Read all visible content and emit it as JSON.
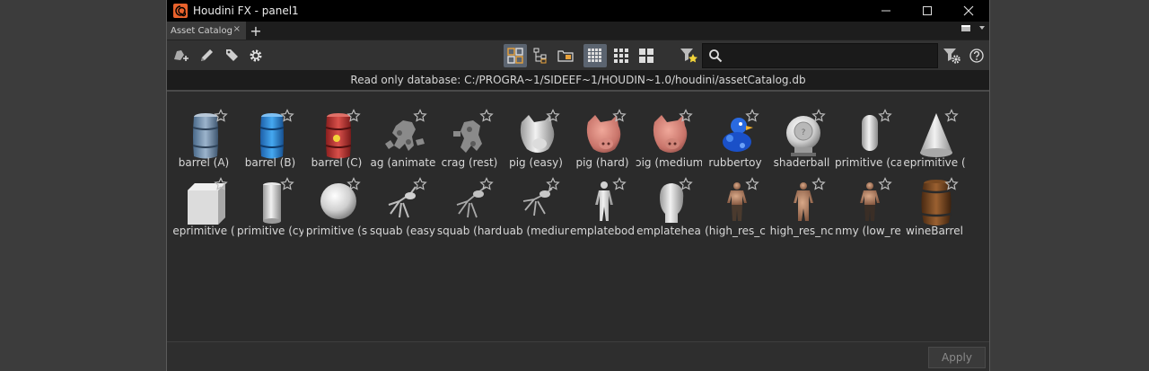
{
  "window": {
    "title": "Houdini FX - panel1"
  },
  "tabs": [
    {
      "label": "Asset Catalog",
      "close": "×"
    }
  ],
  "tab_add": "+",
  "search": {
    "value": "",
    "placeholder": ""
  },
  "database_info": "Read only database: C:/PROGRA~1/SIDEEF~1/HOUDIN~1.0/houdini/assetCatalog.db",
  "assets": [
    {
      "label": "barrel (A)",
      "icon": "barrel-gray-icon"
    },
    {
      "label": "barrel (B)",
      "icon": "barrel-blue-icon"
    },
    {
      "label": "barrel (C)",
      "icon": "barrel-red-icon"
    },
    {
      "label": "ag (animate",
      "icon": "crag-animated-icon"
    },
    {
      "label": "crag (rest)",
      "icon": "crag-rest-icon"
    },
    {
      "label": "pig (easy)",
      "icon": "pig-easy-icon"
    },
    {
      "label": "pig (hard)",
      "icon": "pig-hard-icon"
    },
    {
      "label": "ɔig (medium",
      "icon": "pig-medium-icon"
    },
    {
      "label": "rubbertoy",
      "icon": "rubbertoy-icon"
    },
    {
      "label": "shaderball",
      "icon": "shaderball-icon"
    },
    {
      "label": "primitive (ca",
      "icon": "capsule-icon"
    },
    {
      "label": "eprimitive (",
      "icon": "cone-icon"
    },
    {
      "label": "eprimitive (",
      "icon": "box-icon"
    },
    {
      "label": "primitive (cy",
      "icon": "cylinder-icon"
    },
    {
      "label": "primitive (s",
      "icon": "sphere-icon"
    },
    {
      "label": "squab (easy)",
      "icon": "squab-easy-icon"
    },
    {
      "label": "squab (hard",
      "icon": "squab-hard-icon"
    },
    {
      "label": "uab (mediun",
      "icon": "squab-medium-icon"
    },
    {
      "label": "emplatebod",
      "icon": "template-body-icon"
    },
    {
      "label": "emplatehea",
      "icon": "template-head-icon"
    },
    {
      "label": "(high_res_c",
      "icon": "dummy-high-res-clothed-icon"
    },
    {
      "label": "high_res_nc",
      "icon": "dummy-high-res-noclothes-icon"
    },
    {
      "label": "nmy (low_re",
      "icon": "dummy-low-res-icon"
    },
    {
      "label": "wineBarrel",
      "icon": "wine-barrel-icon"
    }
  ],
  "footer": {
    "apply_label": "Apply"
  },
  "colors": {
    "active_button": "#5b6470",
    "accent_orange": "#e8622c"
  }
}
